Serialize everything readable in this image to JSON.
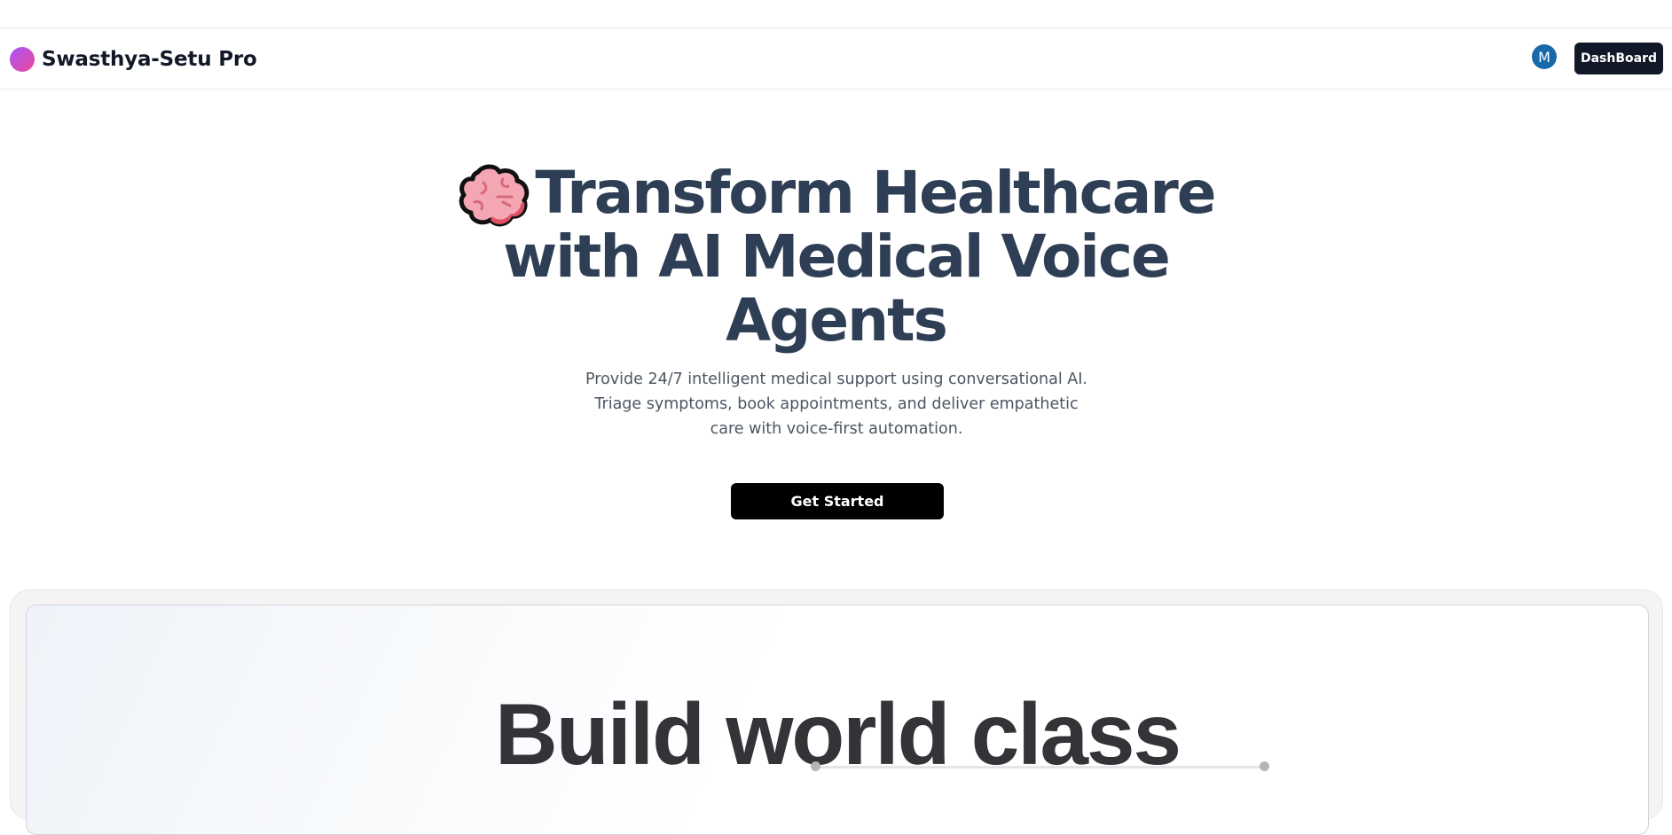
{
  "brand": {
    "name": "Swasthya-Setu Pro",
    "logo_gradient": [
      "#a855f7",
      "#ec4899"
    ]
  },
  "header": {
    "avatar_initial": "M",
    "avatar_color": "#1769aa",
    "dashboard_label": "DashBoard"
  },
  "hero": {
    "icon": "brain-icon",
    "title": "Transform Healthcare with AI Medical Voice Agents",
    "subtitle": "Provide 24/7 intelligent medical support using conversational AI. Triage symptoms, book appointments, and deliver empathetic care with voice-first automation.",
    "cta_label": "Get Started",
    "title_color": "#2e3e55"
  },
  "showcase": {
    "title": "Build world class"
  }
}
